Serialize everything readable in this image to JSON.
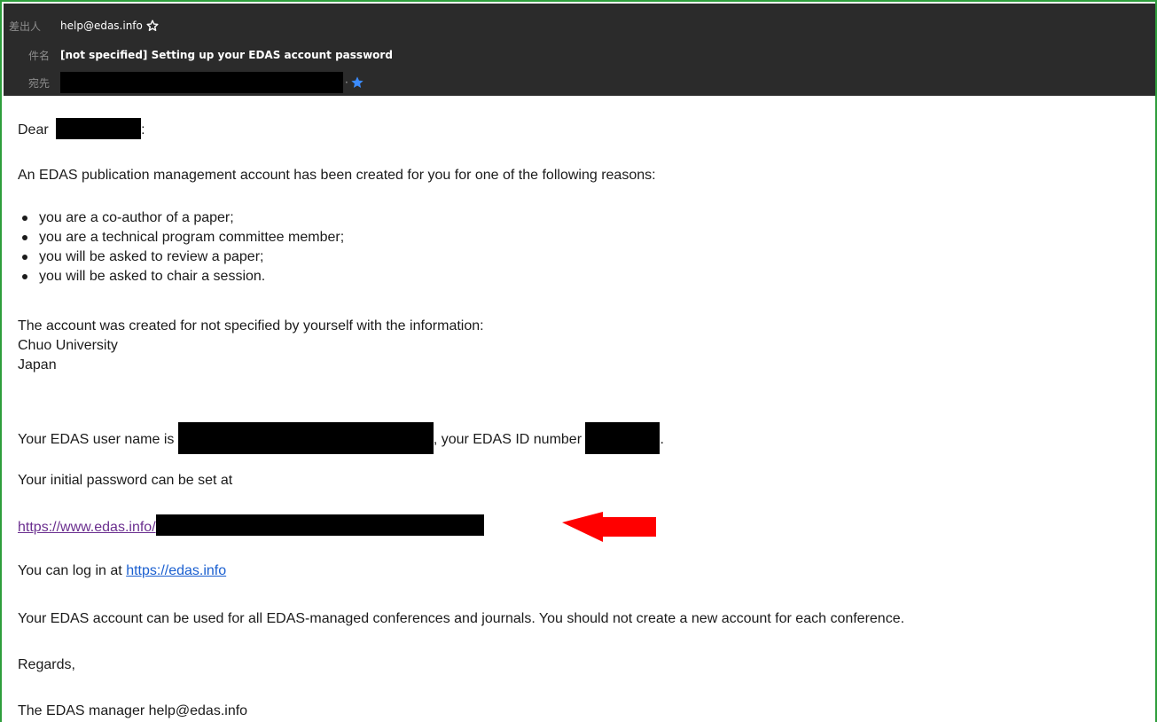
{
  "header": {
    "from_label": "差出人",
    "from_value": "help@edas.info",
    "subject_label": "件名",
    "subject_value": "[not specified] Setting up your EDAS account password",
    "to_label": "宛先",
    "to_separator": "·"
  },
  "icons": {
    "from_star": "star-outline-icon",
    "to_star": "star-filled-blue-icon",
    "annotation": "red-left-arrow"
  },
  "colors": {
    "header_bg": "#2b2b2b",
    "frame_border": "#2e9e3c",
    "visited_link": "#6b2f8f",
    "link": "#1a5fd0",
    "arrow": "#ff0000",
    "star_blue": "#3b8cff"
  },
  "body": {
    "greeting_prefix": "Dear",
    "greeting_suffix": ":",
    "intro": "An EDAS publication management account has been created for you for one of the following reasons:",
    "reasons": [
      "you are a co-author of a paper;",
      "you are a technical program committee member;",
      "you will be asked to review a paper;",
      "you will be asked to chair a session."
    ],
    "created_for": "The account was created for not specified by yourself with the information:",
    "affiliation": "Chuo University",
    "country": "Japan",
    "username_prefix": "Your EDAS user name is",
    "username_mid": ", your EDAS ID number",
    "username_suffix": ".",
    "password_intro": "Your initial password can be set at",
    "password_link_prefix": "https://www.edas.info/",
    "login_prefix": "You can log in at",
    "login_link": "https://edas.info",
    "usage_note": "Your EDAS account can be used for all EDAS-managed conferences and journals. You should not create a new account for each conference.",
    "regards": "Regards,",
    "signature": "The EDAS manager help@edas.info"
  }
}
